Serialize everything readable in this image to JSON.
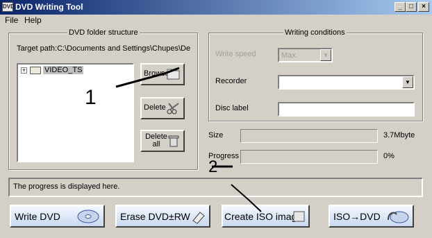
{
  "window": {
    "title": "DVD Writing Tool",
    "app_icon_text": "DVD"
  },
  "window_controls": {
    "minimize": "_",
    "maximize": "□",
    "close": "×"
  },
  "menu": [
    "File",
    "Help"
  ],
  "folder_group": {
    "title": "DVD folder structure",
    "target_path": "Target path:C:\\Documents and Settings\\Chupes\\De",
    "tree": {
      "expand": "+",
      "item": "VIDEO_TS"
    },
    "buttons": {
      "browse": "Browse...",
      "delete": "Delete",
      "delete_all": "Delete all"
    }
  },
  "writing_group": {
    "title": "Writing conditions",
    "write_speed_label": "Write speed",
    "write_speed_value": "Max.",
    "recorder_label": "Recorder",
    "recorder_value": "",
    "disc_label_label": "Disc label",
    "disc_label_value": ""
  },
  "size": {
    "label": "Size",
    "value": "3.7Mbyte"
  },
  "progress": {
    "label": "Progress",
    "value": "0%",
    "fraction": 0
  },
  "status_text": "The progress is displayed here.",
  "actions": {
    "write_dvd": "Write DVD",
    "erase_dvd": "Erase DVD±RW",
    "create_iso": "Create ISO image",
    "iso_to_dvd": "ISO→DVD"
  },
  "annotations": {
    "one": "1",
    "two": "2"
  }
}
